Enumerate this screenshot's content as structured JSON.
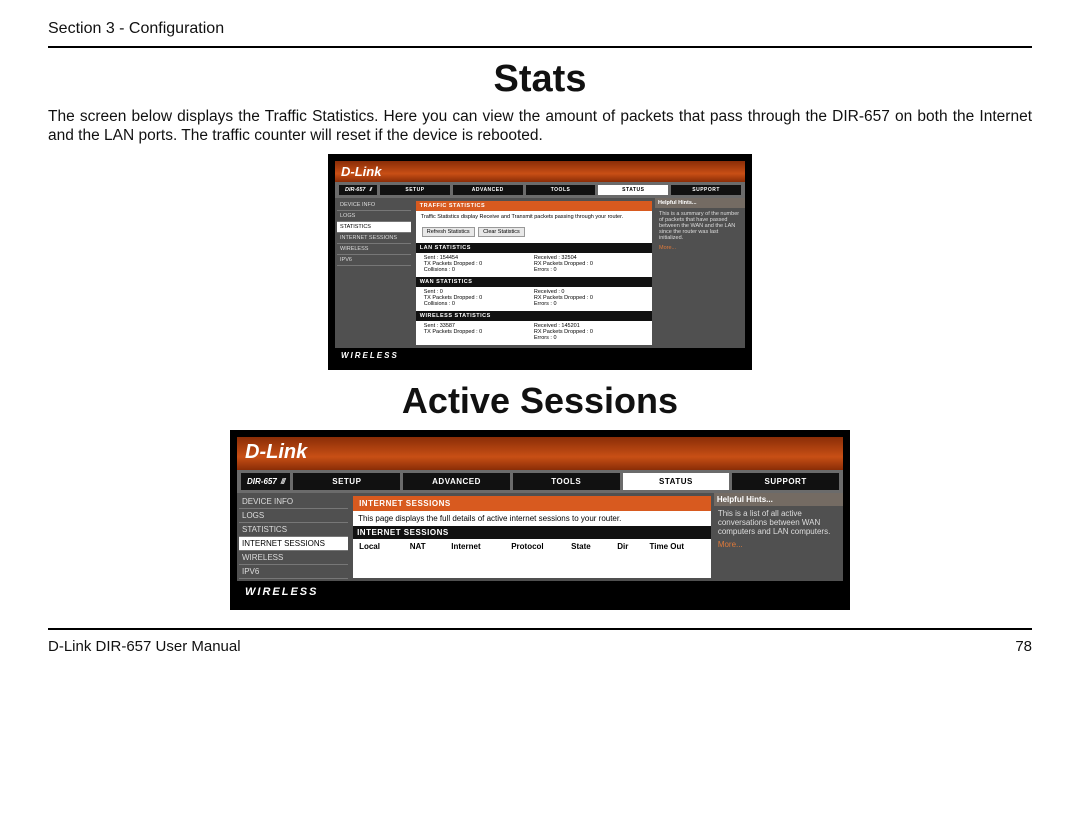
{
  "page": {
    "section_header": "Section 3 - Configuration",
    "title_stats": "Stats",
    "intro": "The screen below displays the Traffic Statistics. Here you can view the amount of packets that pass through the DIR-657 on both the Internet and the LAN ports. The traffic counter will reset if the device is rebooted.",
    "title_active": "Active Sessions",
    "footer_left": "D-Link DIR-657 User Manual",
    "footer_right": "78"
  },
  "router_common": {
    "brand": "D-Link",
    "model": "DIR-657",
    "tabs": [
      "SETUP",
      "ADVANCED",
      "TOOLS",
      "STATUS",
      "SUPPORT"
    ],
    "footer_word": "WIRELESS"
  },
  "stats_shot": {
    "side_items": [
      "DEVICE INFO",
      "LOGS",
      "STATISTICS",
      "INTERNET SESSIONS",
      "WIRELESS",
      "IPV6"
    ],
    "side_active_index": 2,
    "title": "TRAFFIC STATISTICS",
    "desc": "Traffic Statistics display Receive and Transmit packets passing through your router.",
    "btn_refresh": "Refresh Statistics",
    "btn_clear": "Clear Statistics",
    "hints_head": "Helpful Hints...",
    "hints_body": "This is a summary of the number of packets that have passed between the WAN and the LAN since the router was last initialized.",
    "hints_more": "More...",
    "sections": [
      {
        "head": "LAN STATISTICS",
        "rows": [
          [
            "Sent : 154454",
            "Received : 32504"
          ],
          [
            "TX Packets Dropped : 0",
            "RX Packets Dropped : 0"
          ],
          [
            "Collisions : 0",
            "Errors : 0"
          ]
        ]
      },
      {
        "head": "WAN STATISTICS",
        "rows": [
          [
            "Sent : 0",
            "Received : 0"
          ],
          [
            "TX Packets Dropped : 0",
            "RX Packets Dropped : 0"
          ],
          [
            "Collisions : 0",
            "Errors : 0"
          ]
        ]
      },
      {
        "head": "WIRELESS STATISTICS",
        "rows": [
          [
            "Sent : 33587",
            "Received : 145201"
          ],
          [
            "TX Packets Dropped : 0",
            "RX Packets Dropped : 0"
          ],
          [
            "",
            "Errors : 0"
          ]
        ]
      }
    ]
  },
  "sessions_shot": {
    "side_items": [
      "DEVICE INFO",
      "LOGS",
      "STATISTICS",
      "INTERNET SESSIONS",
      "WIRELESS",
      "IPV6"
    ],
    "side_active_index": 3,
    "title": "INTERNET SESSIONS",
    "desc": "This page displays the full details of active internet sessions to your router.",
    "black_head": "INTERNET SESSIONS",
    "columns": [
      "Local",
      "NAT",
      "Internet",
      "Protocol",
      "State",
      "Dir",
      "Time Out"
    ],
    "hints_head": "Helpful Hints...",
    "hints_body": "This is a list of all active conversations between WAN computers and LAN computers.",
    "hints_more": "More..."
  }
}
